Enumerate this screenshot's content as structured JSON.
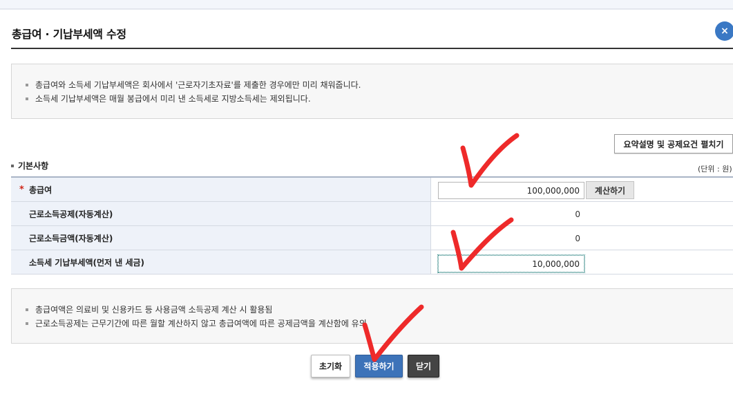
{
  "dialog": {
    "title": "총급여 · 기납부세액 수정",
    "close_symbol": "×"
  },
  "notice_top": [
    "총급여와 소득세 기납부세액은 회사에서 '근로자기초자료'를 제출한 경우에만 미리 채워줍니다.",
    "소득세 기납부세액은 매월 봉급에서 미리 낸 소득세로 지방소득세는 제외됩니다."
  ],
  "summary_button": "요약설명 및 공제요건 펼치기",
  "section": {
    "title": "기본사항",
    "unit": "(단위 : 원)"
  },
  "rows": [
    {
      "label": "총급여",
      "required_mark": "*",
      "value": "100,000,000",
      "button": "계산하기"
    },
    {
      "label": "근로소득공제(자동계산)",
      "value": "0"
    },
    {
      "label": "근로소득금액(자동계산)",
      "value": "0"
    },
    {
      "label": "소득세 기납부세액(먼저 낸 세금)",
      "value": "10,000,000"
    }
  ],
  "notice_bottom": [
    "총급여액은 의료비 및 신용카드 등 사용금액 소득공제 계산 시 활용됨",
    "근로소득공제는 근무기간에 따른 월할 계산하지 않고 총급여액에 따른 공제금액을 계산함에 유의"
  ],
  "actions": {
    "reset": "초기화",
    "apply": "적용하기",
    "close": "닫기"
  },
  "colors": {
    "accent": "#3d73b9",
    "check_mark": "#ee2a2a",
    "label_bg": "#eef2f9"
  },
  "icons": {
    "close": "close-icon",
    "annotation": "check-mark-icon"
  }
}
